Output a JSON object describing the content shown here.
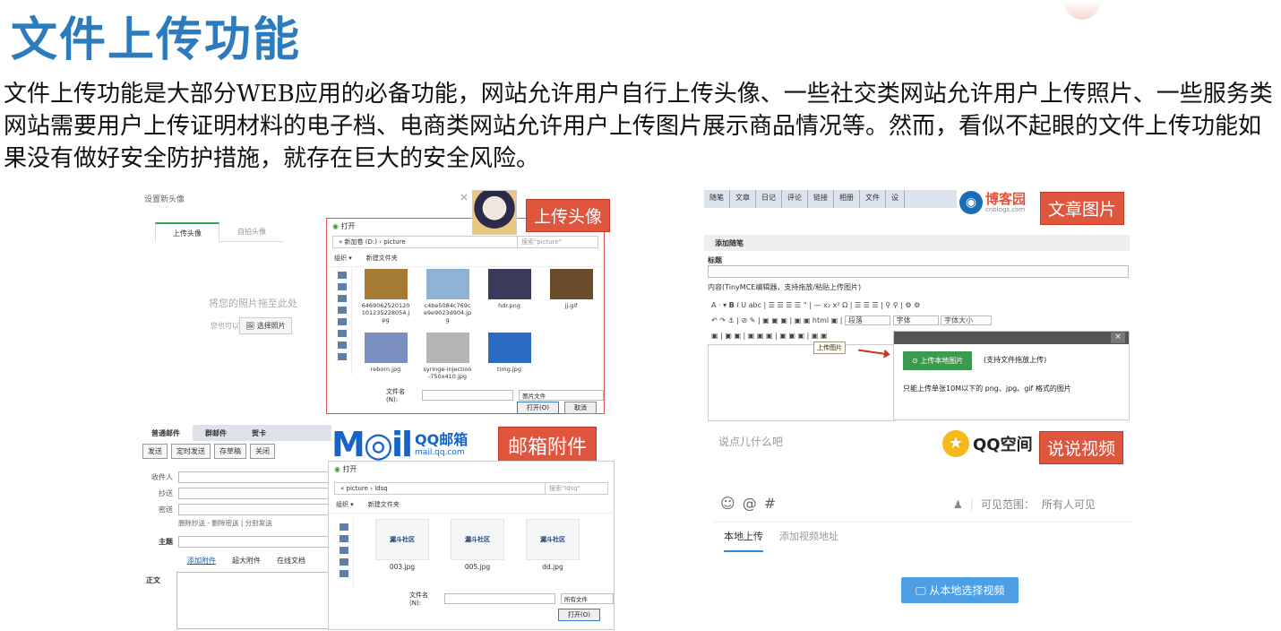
{
  "title": "文件上传功能",
  "intro": "文件上传功能是大部分WEB应用的必备功能，网站允许用户自行上传头像、一些社交类网站允许用户上传照片、一些服务类网站需要用户上传证明材料的电子档、电商类网站允许用户上传图片展示商品情况等。然而，看似不起眼的文件上传功能如果没有做好安全防护措施，就存在巨大的安全风险。",
  "tags": {
    "avatar": "上传头像",
    "article": "文章图片",
    "mail": "邮箱附件",
    "shuoshuo": "说说视频"
  },
  "avatar_panel": {
    "header": "设置新头像",
    "close": "×",
    "tabs": [
      "上传头像",
      "自拍头像"
    ],
    "drop_text": "将您的照片拖至此处",
    "can_text": "您也可以",
    "choose_btn": "选择照片"
  },
  "file_dialog_1": {
    "title": "打开",
    "path": "« 新加卷 (D:) › picture",
    "search": "搜索\"picture\"",
    "toolbar": [
      "组织 ▾",
      "新建文件夹"
    ],
    "files": [
      {
        "name": "6469062520120101235228054.jpg",
        "color": "#a67c35"
      },
      {
        "name": "c4be5084c769ce9e9023d904.jpg",
        "color": "#8fb3d6"
      },
      {
        "name": "hdr.png",
        "color": "#3a3a5a"
      },
      {
        "name": "jj.gif",
        "color": "#6a4c2a"
      },
      {
        "name": "reborn.jpg",
        "color": "#7a8fbf"
      },
      {
        "name": "syringe-injection-750x410.jpg",
        "color": "#b5b5b5"
      },
      {
        "name": "timg.jpg",
        "color": "#2a6cc4"
      }
    ],
    "filename_label": "文件名(N):",
    "filetype": "图片文件",
    "open_btn": "打开(O)",
    "cancel_btn": "取消"
  },
  "blog_panel": {
    "menu": [
      "随笔",
      "文章",
      "日记",
      "评论",
      "链接",
      "相册",
      "文件",
      "设"
    ],
    "section": "添加随笔",
    "title_label": "标题",
    "content_label": "内容(TinyMCE编辑器，支持拖放/粘贴上传图片)",
    "toolbar_selects": [
      "段落",
      "字体",
      "字体大小"
    ],
    "tooltip": "上传图片",
    "upload_btn": "⊙ 上传本地图片",
    "upload_note": "(支持文件拖放上传)",
    "upload_limit": "只能上传单张10M以下的 png、jpg、gif 格式的图片",
    "logo_text": "博客园",
    "logo_sub": "cnblogs.com"
  },
  "mail_panel": {
    "tabs": [
      "普通邮件",
      "群邮件",
      "贺卡"
    ],
    "buttons": [
      "发送",
      "定时发送",
      "存草稿",
      "关闭"
    ],
    "fields": [
      "收件人",
      "抄送",
      "密送"
    ],
    "cc_links": "删除抄送 - 删除密送 | 分别发送",
    "subject": "主题",
    "attach": [
      "添加附件",
      "超大附件",
      "在线文档"
    ],
    "body": "正文",
    "logo_m": "M◎il",
    "logo_qq": "QQ邮箱",
    "logo_sub": "mail.qq.com"
  },
  "file_dialog_2": {
    "title": "打开",
    "path": "« picture › ldsq",
    "search": "搜索\"ldsq\"",
    "toolbar": [
      "组织 ▾",
      "新建文件夹"
    ],
    "files": [
      {
        "name": "003.jpg",
        "label": "漏斗社区"
      },
      {
        "name": "005.jpg",
        "label": "漏斗社区"
      },
      {
        "name": "dd.jpg",
        "label": "漏斗社区"
      }
    ],
    "filename_label": "文件名(N):",
    "filetype": "所有文件",
    "open_btn": "打开(O)"
  },
  "qzone_panel": {
    "placeholder": "说点儿什么吧",
    "visibility_label": "可见范围：",
    "visibility_value": "所有人可见",
    "tabs": [
      "本地上传",
      "添加视频地址"
    ],
    "pick_btn": "从本地选择视频",
    "logo_text": "QQ空间"
  }
}
